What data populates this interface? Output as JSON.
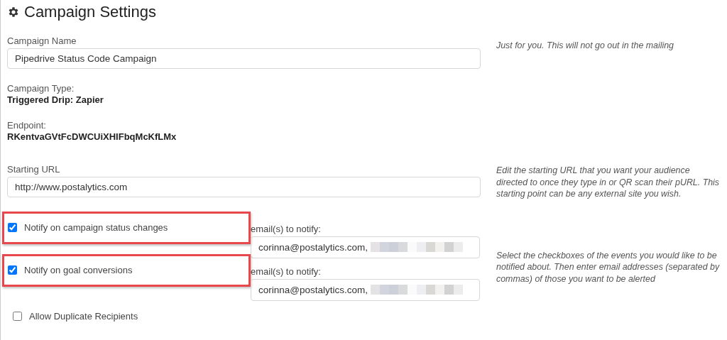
{
  "title": "Campaign Settings",
  "campaign_name": {
    "label": "Campaign Name",
    "value": "Pipedrive Status Code Campaign",
    "help": "Just for you. This will not go out in the mailing"
  },
  "campaign_type": {
    "label": "Campaign Type:",
    "value": "Triggered Drip: Zapier"
  },
  "endpoint": {
    "label": "Endpoint:",
    "value": "RKentvaGVtFcDWCUiXHIFbqMcKfLMx"
  },
  "starting_url": {
    "label": "Starting URL",
    "value": "http://www.postalytics.com",
    "help": "Edit the starting URL that you want your audience directed to once they type in or QR scan their pURL. This starting point can be any external site you wish."
  },
  "notifications": [
    {
      "label": "Notify on campaign status changes",
      "checked": true,
      "highlighted": true,
      "email_label": "email(s) to notify:",
      "email_value": "corinna@postalytics.com,"
    },
    {
      "label": "Notify on goal conversions",
      "checked": true,
      "highlighted": true,
      "email_label": "email(s) to notify:",
      "email_value": "corinna@postalytics.com,"
    }
  ],
  "notifications_help": "Select the checkboxes of the events you would like to be notified about. Then enter email addresses (separated by commas) of those you want to be alerted",
  "allow_duplicates": {
    "label": "Allow Duplicate Recipients",
    "checked": false
  }
}
